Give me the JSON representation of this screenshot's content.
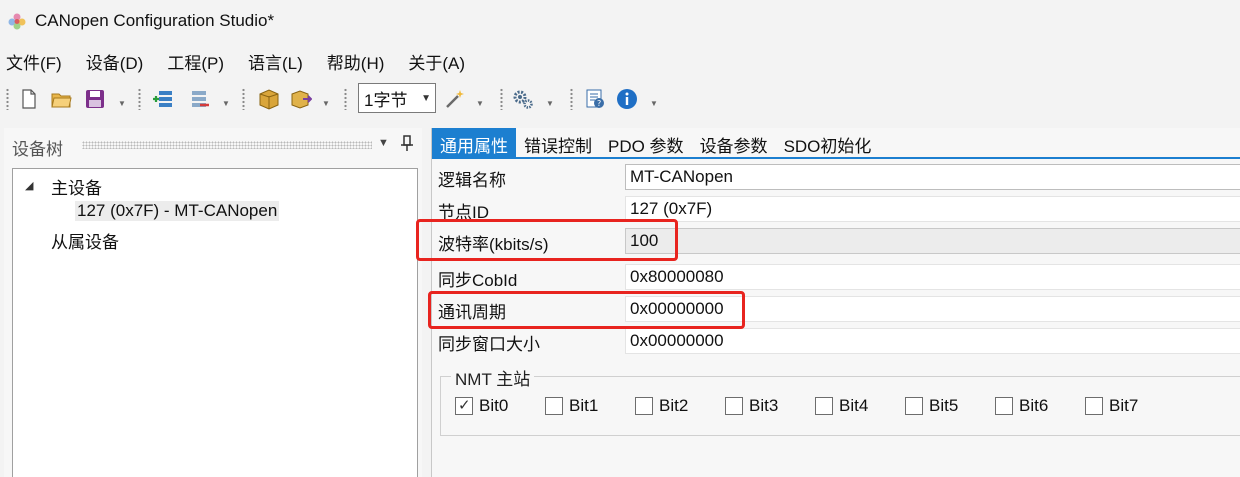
{
  "window": {
    "title": "CANopen Configuration Studio*",
    "app_icon": "flower-logo-icon"
  },
  "menu": [
    "文件(F)",
    "设备(D)",
    "工程(P)",
    "语言(L)",
    "帮助(H)",
    "关于(A)"
  ],
  "toolbar": {
    "icons": [
      "new-file-icon",
      "open-folder-icon",
      "save-icon",
      "add-device-icon",
      "remove-device-icon",
      "package-icon",
      "export-icon",
      "magic-wand-icon",
      "settings-gears-icon",
      "help-file-icon",
      "info-icon"
    ],
    "byte_combo": "1字节"
  },
  "left_panel": {
    "title": "设备树",
    "tree": {
      "master_label": "主设备",
      "master_child": "127 (0x7F)  -  MT-CANopen",
      "slave_label": "从属设备"
    }
  },
  "tabs": [
    {
      "label": "通用属性",
      "active": true
    },
    {
      "label": "错误控制",
      "active": false
    },
    {
      "label": "PDO 参数",
      "active": false
    },
    {
      "label": "设备参数",
      "active": false
    },
    {
      "label": "SDO初始化",
      "active": false
    }
  ],
  "properties": [
    {
      "label": "逻辑名称",
      "value": "MT-CANopen"
    },
    {
      "label": "节点ID",
      "value": "127 (0x7F)"
    },
    {
      "label": "波特率(kbits/s)",
      "value": "100"
    },
    {
      "label": "同步CobId",
      "value": "0x80000080"
    },
    {
      "label": "通讯周期",
      "value": "0x00000000"
    },
    {
      "label": "同步窗口大小",
      "value": "0x00000000"
    }
  ],
  "nmt": {
    "title": "NMT 主站",
    "bits": [
      {
        "label": "Bit0",
        "checked": true
      },
      {
        "label": "Bit1",
        "checked": false
      },
      {
        "label": "Bit2",
        "checked": false
      },
      {
        "label": "Bit3",
        "checked": false
      },
      {
        "label": "Bit4",
        "checked": false
      },
      {
        "label": "Bit5",
        "checked": false
      },
      {
        "label": "Bit6",
        "checked": false
      },
      {
        "label": "Bit7",
        "checked": false
      }
    ]
  },
  "colors": {
    "accent": "#1c7fd0",
    "annotation": "#e8241f"
  }
}
